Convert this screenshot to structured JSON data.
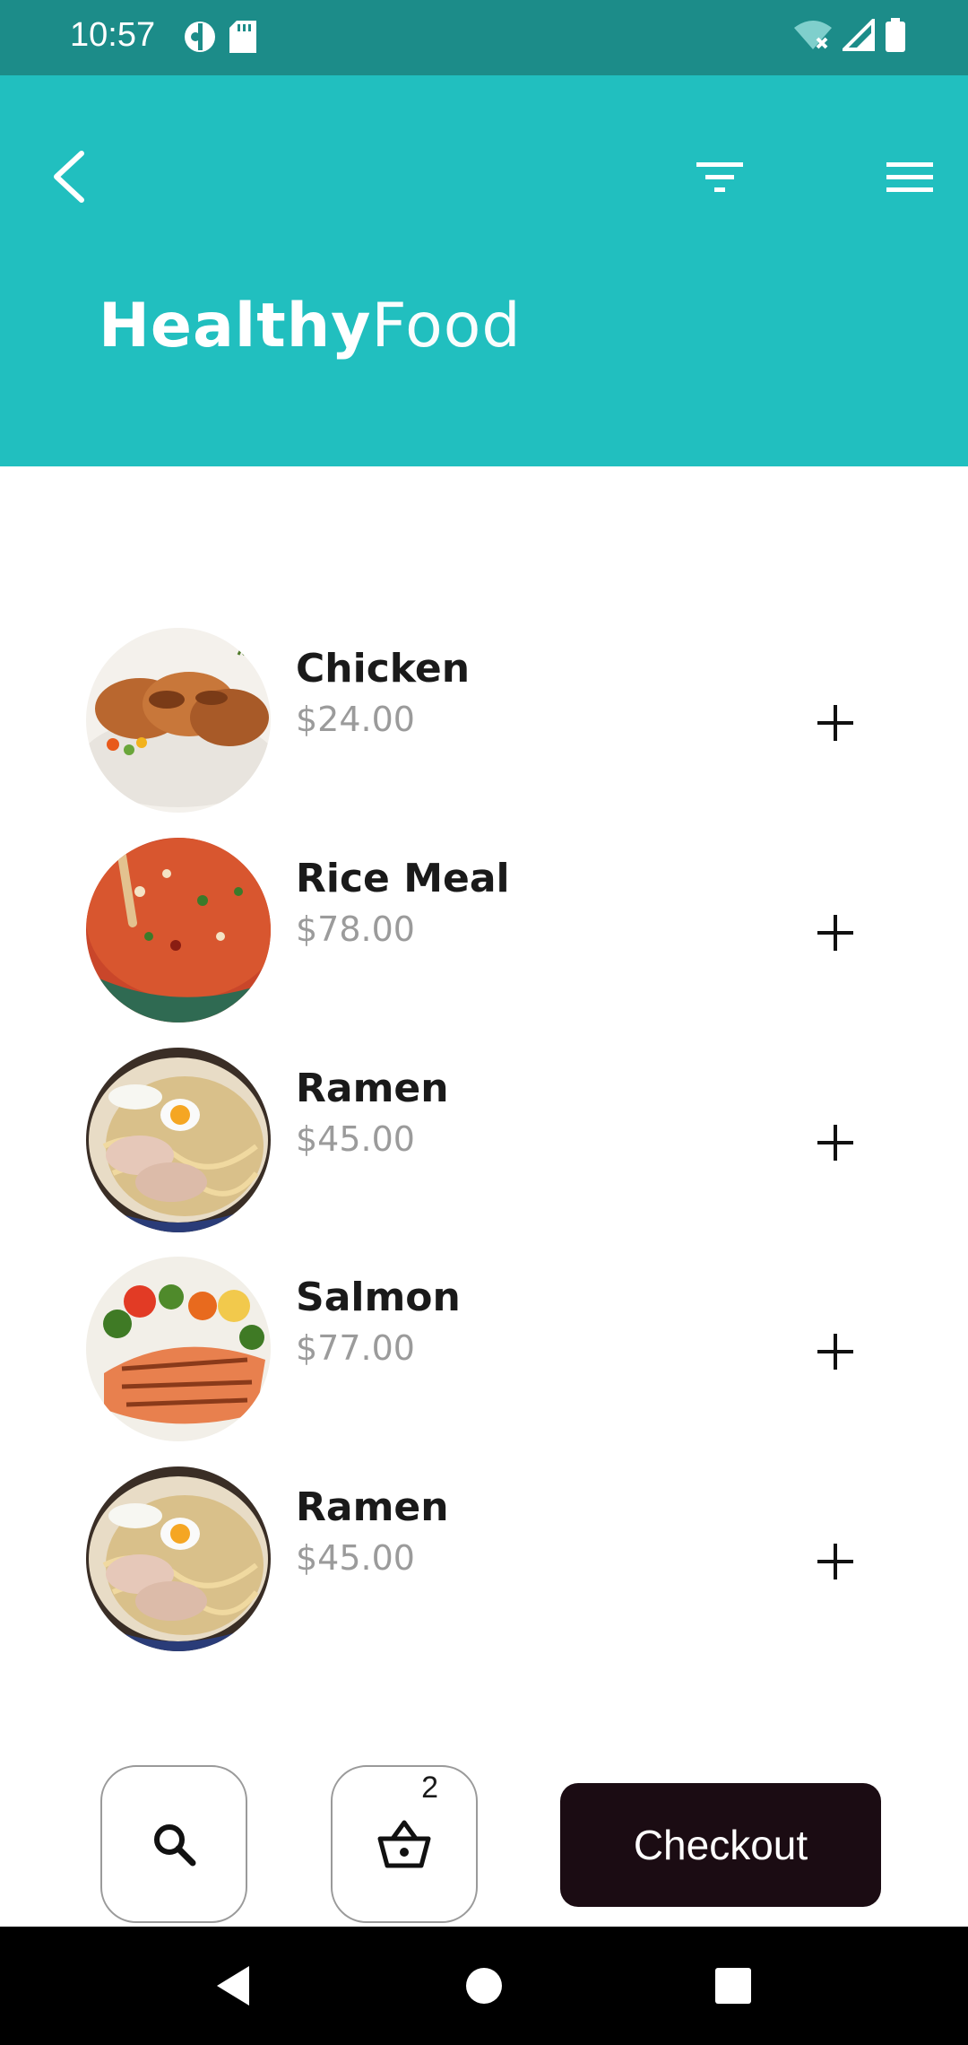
{
  "status_bar": {
    "time": "10:57",
    "icons_left": [
      "app-notification-icon",
      "sd-card-icon"
    ],
    "icons_right": [
      "wifi-off-icon",
      "signal-icon",
      "battery-icon"
    ]
  },
  "header": {
    "title_bold": "Healthy",
    "title_light": "Food",
    "background": "#21BFBF",
    "icons": [
      "back-icon",
      "filter-icon",
      "menu-icon"
    ]
  },
  "items": [
    {
      "name": "Chicken",
      "price": "$24.00"
    },
    {
      "name": "Rice Meal",
      "price": "$78.00"
    },
    {
      "name": "Ramen",
      "price": "$45.00"
    },
    {
      "name": "Salmon",
      "price": "$77.00"
    },
    {
      "name": "Ramen",
      "price": "$45.00"
    }
  ],
  "bottom": {
    "cart_count": "2",
    "checkout_label": "Checkout"
  },
  "colors": {
    "accent": "#21BFBF",
    "status_bar": "#1C8C89",
    "checkout_bg": "#1b0c13",
    "price_text": "#9b9b9b"
  }
}
